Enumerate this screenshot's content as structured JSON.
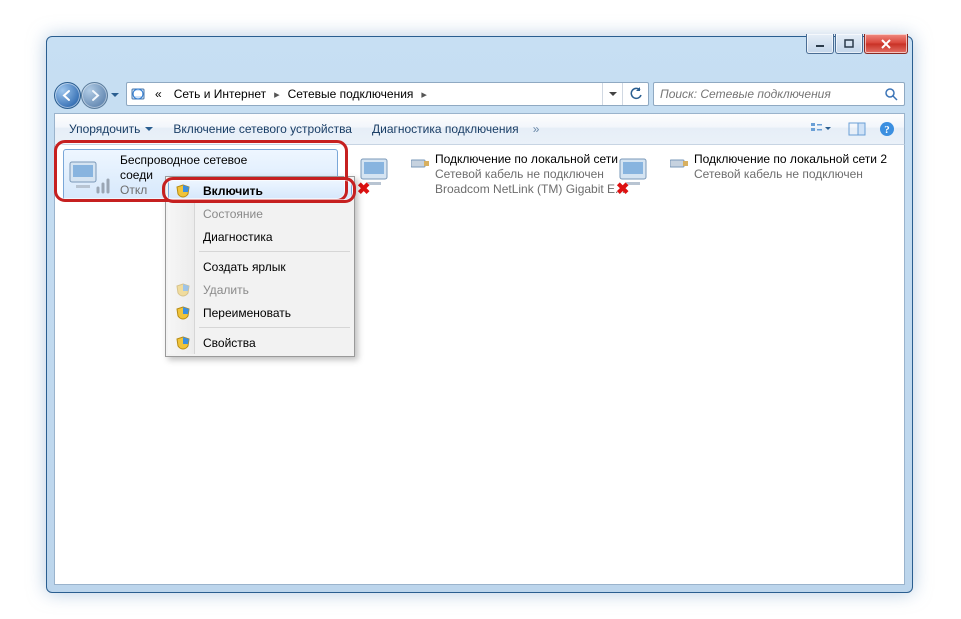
{
  "breadcrumb": {
    "prefix": "«",
    "part1": "Сеть и Интернет",
    "part2": "Сетевые подключения"
  },
  "search": {
    "placeholder": "Поиск: Сетевые подключения"
  },
  "toolbar": {
    "organize": "Упорядочить",
    "enable_device": "Включение сетевого устройства",
    "diagnose": "Диагностика подключения",
    "more": "»"
  },
  "connections": [
    {
      "title_l1": "Беспроводное сетевое",
      "title_l2": "соеди",
      "status_trunc": "Откл"
    },
    {
      "title": "Подключение по локальной сети",
      "status": "Сетевой кабель не подключен",
      "adapter": "Broadcom NetLink (TM) Gigabit E..."
    },
    {
      "title": "Подключение по локальной сети 2",
      "status": "Сетевой кабель не подключен"
    }
  ],
  "context_menu": {
    "enable": "Включить",
    "status": "Состояние",
    "diagnose": "Диагностика",
    "shortcut": "Создать ярлык",
    "delete": "Удалить",
    "rename": "Переименовать",
    "properties": "Свойства"
  }
}
